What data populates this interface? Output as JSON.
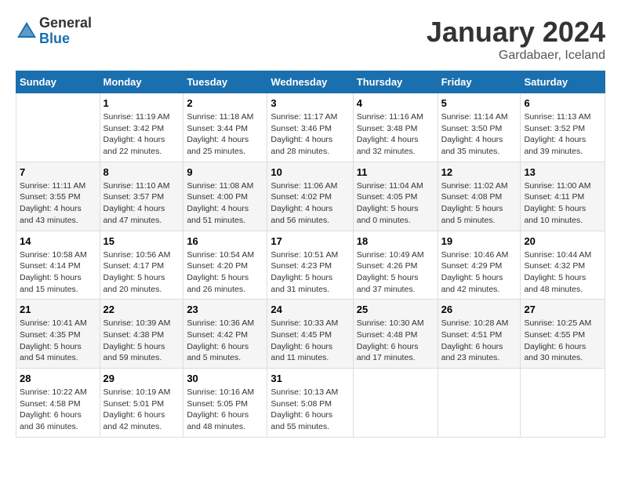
{
  "header": {
    "logo_general": "General",
    "logo_blue": "Blue",
    "month_title": "January 2024",
    "location": "Gardabaer, Iceland"
  },
  "days_of_week": [
    "Sunday",
    "Monday",
    "Tuesday",
    "Wednesday",
    "Thursday",
    "Friday",
    "Saturday"
  ],
  "weeks": [
    [
      {
        "day": "",
        "info": ""
      },
      {
        "day": "1",
        "info": "Sunrise: 11:19 AM\nSunset: 3:42 PM\nDaylight: 4 hours\nand 22 minutes."
      },
      {
        "day": "2",
        "info": "Sunrise: 11:18 AM\nSunset: 3:44 PM\nDaylight: 4 hours\nand 25 minutes."
      },
      {
        "day": "3",
        "info": "Sunrise: 11:17 AM\nSunset: 3:46 PM\nDaylight: 4 hours\nand 28 minutes."
      },
      {
        "day": "4",
        "info": "Sunrise: 11:16 AM\nSunset: 3:48 PM\nDaylight: 4 hours\nand 32 minutes."
      },
      {
        "day": "5",
        "info": "Sunrise: 11:14 AM\nSunset: 3:50 PM\nDaylight: 4 hours\nand 35 minutes."
      },
      {
        "day": "6",
        "info": "Sunrise: 11:13 AM\nSunset: 3:52 PM\nDaylight: 4 hours\nand 39 minutes."
      }
    ],
    [
      {
        "day": "7",
        "info": "Sunrise: 11:11 AM\nSunset: 3:55 PM\nDaylight: 4 hours\nand 43 minutes."
      },
      {
        "day": "8",
        "info": "Sunrise: 11:10 AM\nSunset: 3:57 PM\nDaylight: 4 hours\nand 47 minutes."
      },
      {
        "day": "9",
        "info": "Sunrise: 11:08 AM\nSunset: 4:00 PM\nDaylight: 4 hours\nand 51 minutes."
      },
      {
        "day": "10",
        "info": "Sunrise: 11:06 AM\nSunset: 4:02 PM\nDaylight: 4 hours\nand 56 minutes."
      },
      {
        "day": "11",
        "info": "Sunrise: 11:04 AM\nSunset: 4:05 PM\nDaylight: 5 hours\nand 0 minutes."
      },
      {
        "day": "12",
        "info": "Sunrise: 11:02 AM\nSunset: 4:08 PM\nDaylight: 5 hours\nand 5 minutes."
      },
      {
        "day": "13",
        "info": "Sunrise: 11:00 AM\nSunset: 4:11 PM\nDaylight: 5 hours\nand 10 minutes."
      }
    ],
    [
      {
        "day": "14",
        "info": "Sunrise: 10:58 AM\nSunset: 4:14 PM\nDaylight: 5 hours\nand 15 minutes."
      },
      {
        "day": "15",
        "info": "Sunrise: 10:56 AM\nSunset: 4:17 PM\nDaylight: 5 hours\nand 20 minutes."
      },
      {
        "day": "16",
        "info": "Sunrise: 10:54 AM\nSunset: 4:20 PM\nDaylight: 5 hours\nand 26 minutes."
      },
      {
        "day": "17",
        "info": "Sunrise: 10:51 AM\nSunset: 4:23 PM\nDaylight: 5 hours\nand 31 minutes."
      },
      {
        "day": "18",
        "info": "Sunrise: 10:49 AM\nSunset: 4:26 PM\nDaylight: 5 hours\nand 37 minutes."
      },
      {
        "day": "19",
        "info": "Sunrise: 10:46 AM\nSunset: 4:29 PM\nDaylight: 5 hours\nand 42 minutes."
      },
      {
        "day": "20",
        "info": "Sunrise: 10:44 AM\nSunset: 4:32 PM\nDaylight: 5 hours\nand 48 minutes."
      }
    ],
    [
      {
        "day": "21",
        "info": "Sunrise: 10:41 AM\nSunset: 4:35 PM\nDaylight: 5 hours\nand 54 minutes."
      },
      {
        "day": "22",
        "info": "Sunrise: 10:39 AM\nSunset: 4:38 PM\nDaylight: 5 hours\nand 59 minutes."
      },
      {
        "day": "23",
        "info": "Sunrise: 10:36 AM\nSunset: 4:42 PM\nDaylight: 6 hours\nand 5 minutes."
      },
      {
        "day": "24",
        "info": "Sunrise: 10:33 AM\nSunset: 4:45 PM\nDaylight: 6 hours\nand 11 minutes."
      },
      {
        "day": "25",
        "info": "Sunrise: 10:30 AM\nSunset: 4:48 PM\nDaylight: 6 hours\nand 17 minutes."
      },
      {
        "day": "26",
        "info": "Sunrise: 10:28 AM\nSunset: 4:51 PM\nDaylight: 6 hours\nand 23 minutes."
      },
      {
        "day": "27",
        "info": "Sunrise: 10:25 AM\nSunset: 4:55 PM\nDaylight: 6 hours\nand 30 minutes."
      }
    ],
    [
      {
        "day": "28",
        "info": "Sunrise: 10:22 AM\nSunset: 4:58 PM\nDaylight: 6 hours\nand 36 minutes."
      },
      {
        "day": "29",
        "info": "Sunrise: 10:19 AM\nSunset: 5:01 PM\nDaylight: 6 hours\nand 42 minutes."
      },
      {
        "day": "30",
        "info": "Sunrise: 10:16 AM\nSunset: 5:05 PM\nDaylight: 6 hours\nand 48 minutes."
      },
      {
        "day": "31",
        "info": "Sunrise: 10:13 AM\nSunset: 5:08 PM\nDaylight: 6 hours\nand 55 minutes."
      },
      {
        "day": "",
        "info": ""
      },
      {
        "day": "",
        "info": ""
      },
      {
        "day": "",
        "info": ""
      }
    ]
  ]
}
